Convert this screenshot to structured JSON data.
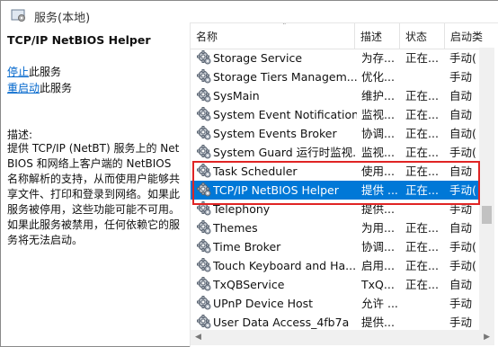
{
  "window": {
    "title": "服务(本地)"
  },
  "left_panel": {
    "service_title": "TCP/IP NetBIOS Helper",
    "actions": [
      {
        "link": "停止",
        "rest": "此服务"
      },
      {
        "link": "重启动",
        "rest": "此服务"
      }
    ],
    "description_label": "描述:",
    "description": "提供 TCP/IP (NetBT) 服务上的 NetBIOS 和网络上客户端的 NetBIOS 名称解析的支持，从而使用户能够共享文件、打印和登录到网络。如果此服务被停用，这些功能可能不可用。如果此服务被禁用，任何依赖它的服务将无法启动。"
  },
  "list": {
    "columns": [
      "名称",
      "描述",
      "状态",
      "启动类"
    ],
    "rows": [
      {
        "name": "Storage Service",
        "desc": "为存...",
        "state": "正在...",
        "start": "手动("
      },
      {
        "name": "Storage Tiers Managem...",
        "desc": "优化...",
        "state": "",
        "start": "手动"
      },
      {
        "name": "SysMain",
        "desc": "维护...",
        "state": "正在...",
        "start": "自动"
      },
      {
        "name": "System Event Notification...",
        "desc": "监视...",
        "state": "正在...",
        "start": "自动"
      },
      {
        "name": "System Events Broker",
        "desc": "协调...",
        "state": "正在...",
        "start": "自动("
      },
      {
        "name": "System Guard 运行时监视...",
        "desc": "监视...",
        "state": "正在...",
        "start": "手动("
      },
      {
        "name": "Task Scheduler",
        "desc": "使用...",
        "state": "正在...",
        "start": "自动"
      },
      {
        "name": "TCP/IP NetBIOS Helper",
        "desc": "提供 ...",
        "state": "正在...",
        "start": "手动("
      },
      {
        "name": "Telephony",
        "desc": "提供...",
        "state": "",
        "start": "手动"
      },
      {
        "name": "Themes",
        "desc": "为用...",
        "state": "正在...",
        "start": "自动"
      },
      {
        "name": "Time Broker",
        "desc": "协调...",
        "state": "正在...",
        "start": "手动("
      },
      {
        "name": "Touch Keyboard and Ha...",
        "desc": "启用...",
        "state": "正在...",
        "start": "手动("
      },
      {
        "name": "TxQBService",
        "desc": "TxQ...",
        "state": "正在...",
        "start": "自动"
      },
      {
        "name": "UPnP Device Host",
        "desc": "允许 ...",
        "state": "",
        "start": "手动"
      },
      {
        "name": "User Data Access_4fb7a",
        "desc": "提供...",
        "state": "",
        "start": "手动"
      }
    ],
    "selected_index": 7
  },
  "colors": {
    "selection": "#0078d7",
    "highlight": "#e02424",
    "link": "#0066cc"
  },
  "icons": {
    "service": "gear-icon",
    "app": "services-icon"
  }
}
